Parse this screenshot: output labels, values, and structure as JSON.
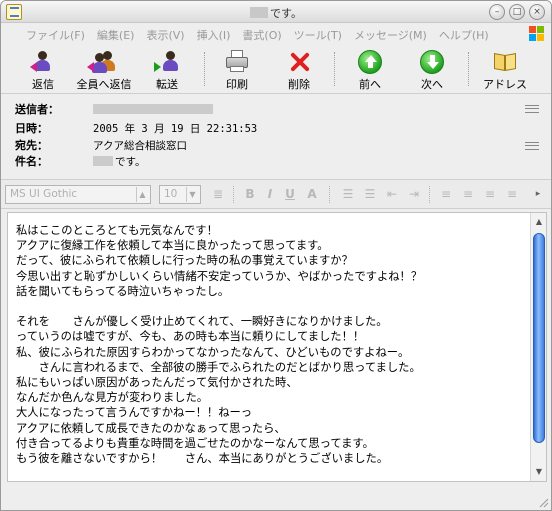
{
  "window": {
    "title": "です。",
    "buttons": [
      "minimize",
      "maximize",
      "close"
    ]
  },
  "menu": [
    "ファイル(F)",
    "編集(E)",
    "表示(V)",
    "挿入(I)",
    "書式(O)",
    "ツール(T)",
    "メッセージ(M)",
    "ヘルプ(H)"
  ],
  "toolbar": {
    "reply": "返信",
    "reply_all": "全員へ返信",
    "forward": "転送",
    "print": "印刷",
    "delete": "削除",
    "prev": "前へ",
    "next": "次へ",
    "address": "アドレス"
  },
  "headers": {
    "from_label": "送信者：",
    "date_label": "日時：",
    "date_value": "2005 年 3 月 19 日 22:31:53",
    "to_label": "宛先：",
    "to_value": "アクア総合相談窓口",
    "subject_label": "件名：",
    "subject_value": "です。"
  },
  "format": {
    "font": "MS UI Gothic",
    "size": "10"
  },
  "body": {
    "lines": [
      "私はここのところとても元気なんです！",
      "アクアに復縁工作を依頼して本当に良かったって思ってます。",
      "だって、彼にふられて依頼しに行った時の私の事覚えていますか？",
      "今思い出すと恥ずかしいくらい情緒不安定っていうか、やばかったですよね！？",
      "話を聞いてもらってる時泣いちゃったし。",
      "",
      "それを　　さんが優しく受け止めてくれて、一瞬好きになりかけました。",
      "っていうのは嘘ですが、今も、あの時も本当に頼りにしてました！！",
      "私、彼にふられた原因すらわかってなかったなんて、ひどいものですよねー。",
      "　　さんに言われるまで、全部彼の勝手でふられたのだとばかり思ってました。",
      "私にもいっぱい原因があったんだって気付かされた時、",
      "なんだか色んな見方が変わりました。",
      "大人になったって言うんですかねー！！ねーっ",
      "アクアに依頼して成長できたのかなぁって思ったら、",
      "付き合ってるよりも貴重な時間を過ごせたのかなーなんて思ってます。",
      "もう彼を離さないですから！　　さん、本当にありがとうございました。"
    ]
  },
  "colors": {
    "accent_green": "#1fa21f",
    "scroll_blue": "#2f6fd8",
    "person_purple": "#6a4bc2",
    "delete_red": "#e02020"
  }
}
